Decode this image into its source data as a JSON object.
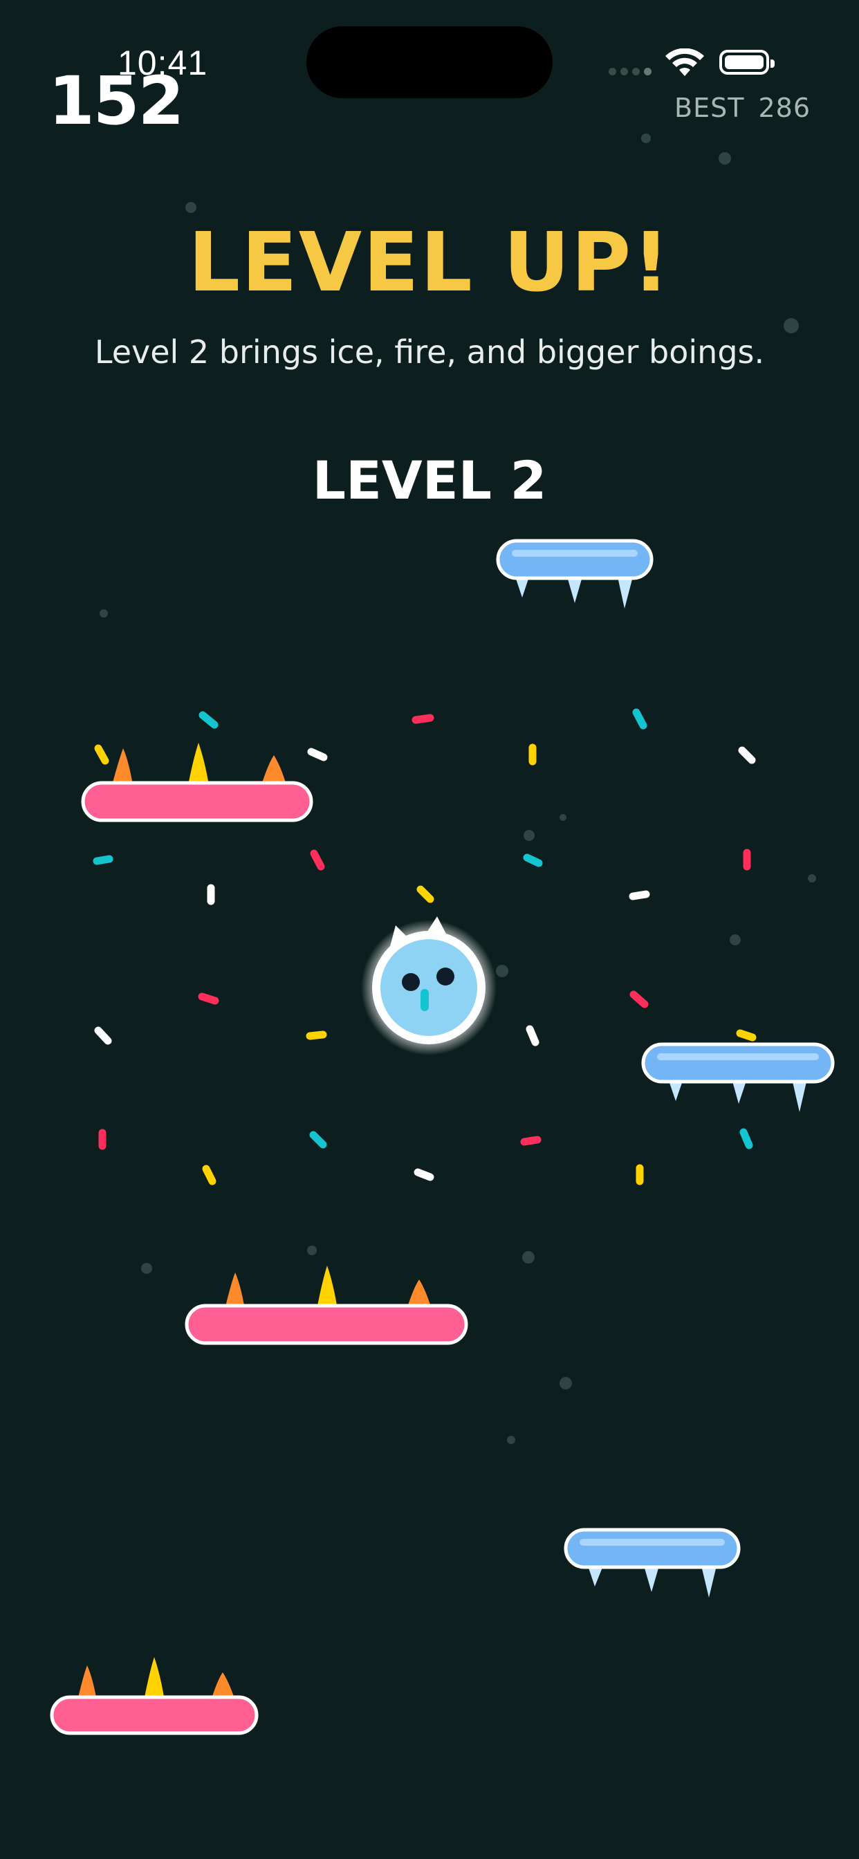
{
  "status_bar": {
    "time": "10:41",
    "wifi_icon": "wifi-icon",
    "battery_icon": "battery-icon",
    "signal_icon": "cellular-signal-icon"
  },
  "hud": {
    "score": "152",
    "best_label": "BEST",
    "best_value": "286"
  },
  "banner": {
    "title": "LEVEL UP!",
    "subtitle": "Level 2 brings ice, fire, and bigger boings.",
    "level_label": "LEVEL 2"
  },
  "colors": {
    "background": "#0c1f1e",
    "title": "#f6c843",
    "fire_platform": "#ff5f93",
    "ice_platform": "#74b6f5",
    "player": "#8fd3f4",
    "confetti_yellow": "#ffd300",
    "confetti_cyan": "#14c4d0",
    "confetti_pink": "#ff2e5a",
    "confetti_white": "#ffffff",
    "flame_orange": "#ff8a2c",
    "flame_yellow": "#ffd200"
  },
  "game": {
    "platforms": [
      {
        "type": "ice"
      },
      {
        "type": "fire"
      },
      {
        "type": "ice"
      },
      {
        "type": "fire"
      },
      {
        "type": "ice"
      },
      {
        "type": "fire"
      }
    ],
    "player": {
      "character": "blue-ball-creature"
    },
    "confetti_burst": true
  }
}
